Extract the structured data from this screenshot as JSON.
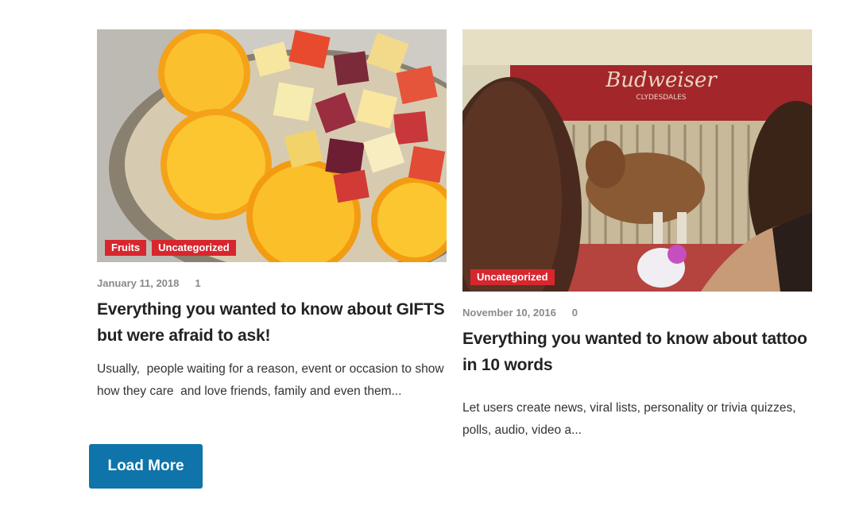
{
  "posts": [
    {
      "categories": [
        "Fruits",
        "Uncategorized"
      ],
      "date": "January 11, 2018",
      "comments": "1",
      "title": "Everything you wanted to know about GIFTS but were afraid to ask!",
      "excerpt": "Usually,  people waiting for a reason, event or occasion to show how they care  and love friends, family and even them..."
    },
    {
      "categories": [
        "Uncategorized"
      ],
      "date": "November 10, 2016",
      "comments": "0",
      "title": "Everything you wanted to know about tattoo in 10 words",
      "excerpt": "Let users create news, viral lists, personality or trivia quizzes, polls, audio, video a..."
    }
  ],
  "image_text": {
    "sign_main": "Budweiser",
    "sign_sub": "CLYDESDALES"
  },
  "load_more_label": "Load More",
  "colors": {
    "category_badge": "#d8262e",
    "button": "#0f74a9"
  }
}
